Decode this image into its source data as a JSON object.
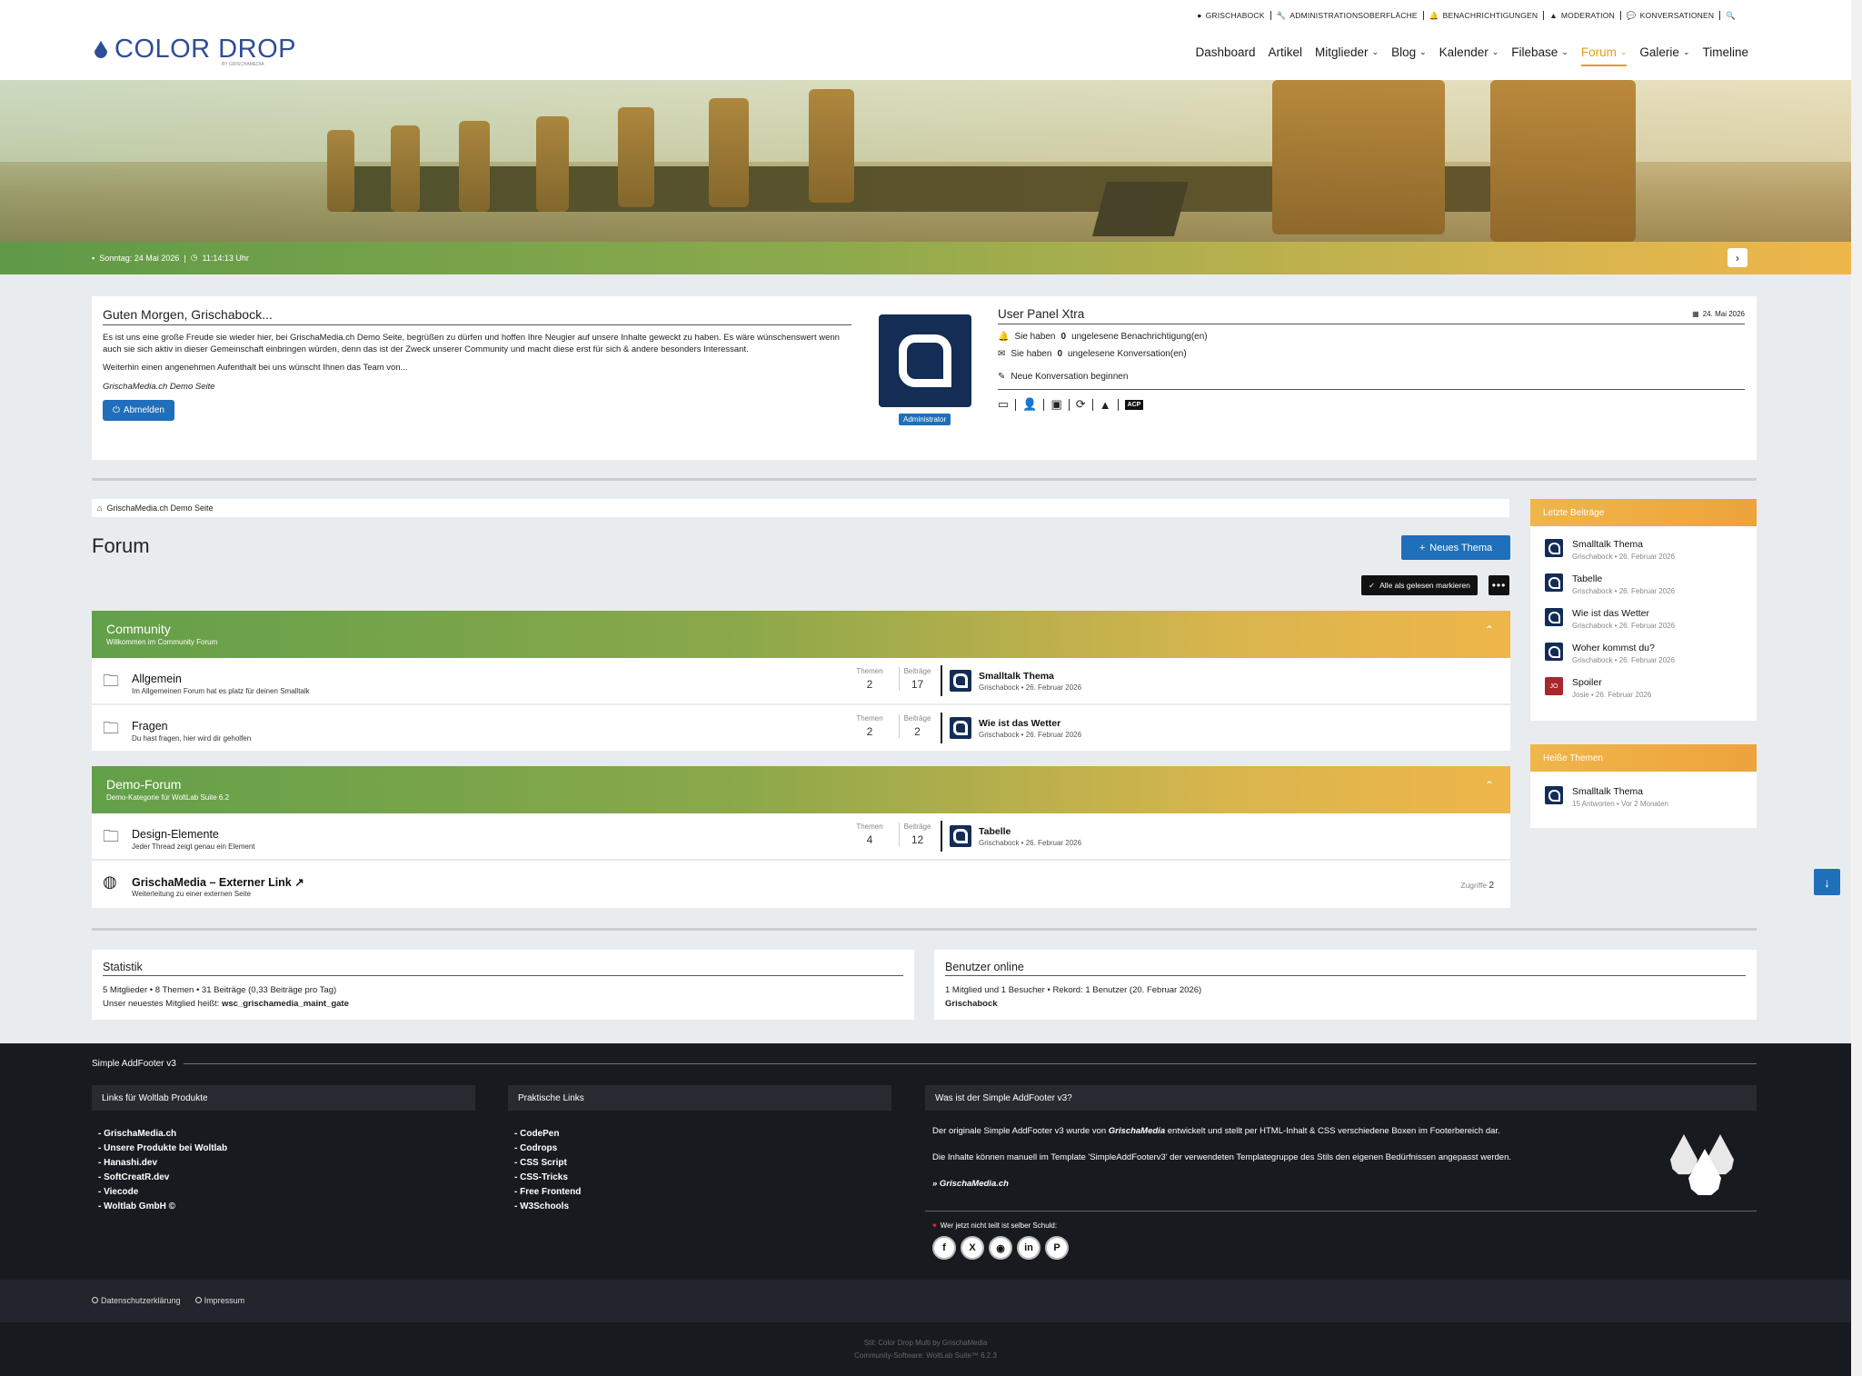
{
  "topbar": {
    "links": [
      {
        "icon": "user-circle-icon",
        "label": "GRISCHABOCK"
      },
      {
        "icon": "wrench-icon",
        "label": "ADMINISTRATIONSOBERFLÄCHE"
      },
      {
        "icon": "bell-icon",
        "label": "BENACHRICHTIGUNGEN"
      },
      {
        "icon": "warning-icon",
        "label": "MODERATION"
      },
      {
        "icon": "chat-icon",
        "label": "KONVERSATIONEN"
      }
    ]
  },
  "logo": {
    "name": "COLOR DROP",
    "sub": "BY GRISCHAMEDIA"
  },
  "nav": [
    {
      "label": "Dashboard",
      "dropdown": false
    },
    {
      "label": "Artikel",
      "dropdown": false
    },
    {
      "label": "Mitglieder",
      "dropdown": true
    },
    {
      "label": "Blog",
      "dropdown": true
    },
    {
      "label": "Kalender",
      "dropdown": true
    },
    {
      "label": "Filebase",
      "dropdown": true
    },
    {
      "label": "Forum",
      "dropdown": true,
      "active": true
    },
    {
      "label": "Galerie",
      "dropdown": true
    },
    {
      "label": "Timeline",
      "dropdown": false
    }
  ],
  "hero": {
    "date": "Sonntag: 24 Mai 2026",
    "time": "11:14:13 Uhr"
  },
  "welcome": {
    "title": "Guten Morgen, Grischabock...",
    "p1": "Es ist uns eine große Freude sie wieder hier, bei GrischaMedia.ch Demo Seite, begrüßen zu dürfen und hoffen Ihre Neugier auf unsere Inhalte geweckt zu haben. Es wäre wünschenswert wenn auch sie sich aktiv in dieser Gemeinschaft einbringen würden, denn das ist der Zweck unserer Community und macht diese erst für sich & andere besonders Interessant.",
    "p2": "Weiterhin einen angenehmen Aufenthalt bei uns wünscht Ihnen das Team von...",
    "signature": "GrischaMedia.ch Demo Seite",
    "logout": "Abmelden",
    "badge": "Administrator"
  },
  "userpanel": {
    "title": "User Panel Xtra",
    "date": "24. Mai 2026",
    "notif_pre": "Sie haben",
    "notif_count": "0",
    "notif_post": "ungelesene Benachrichtigung(en)",
    "conv_pre": "Sie haben",
    "conv_count": "0",
    "conv_post": "ungelesene Konversation(en)",
    "new_conv": "Neue Konversation beginnen",
    "acp": "ACP"
  },
  "breadcrumb": "GrischaMedia.ch Demo Seite",
  "forum": {
    "title": "Forum",
    "new_thread": "Neues Thema",
    "mark_read": "Alle als gelesen markieren"
  },
  "stat_labels": {
    "threads": "Themen",
    "posts": "Beiträge",
    "hits": "Zugriffe"
  },
  "categories": [
    {
      "title": "Community",
      "subtitle": "Willkommen im Community Forum",
      "boards": [
        {
          "name": "Allgemein",
          "desc": "Im Allgemeinen Forum hat es platz für deinen Smalltalk",
          "threads": "2",
          "posts": "17",
          "last_title": "Smalltalk Thema",
          "last_meta": "Grischabock • 26. Februar 2026"
        },
        {
          "name": "Fragen",
          "desc": "Du hast fragen, hier wird dir geholfen",
          "threads": "2",
          "posts": "2",
          "last_title": "Wie ist das Wetter",
          "last_meta": "Grischabock • 26. Februar 2026"
        }
      ]
    },
    {
      "title": "Demo-Forum",
      "subtitle": "Demo-Kategorie für WoltLab Suite 6.2",
      "boards": [
        {
          "name": "Design-Elemente",
          "desc": "Jeder Thread zeigt genau ein Element",
          "threads": "4",
          "posts": "12",
          "last_title": "Tabelle",
          "last_meta": "Grischabock • 26. Februar 2026"
        },
        {
          "name": "GrischaMedia – Externer Link",
          "desc": "Weiterleitung zu einer externen Seite",
          "hits": "2"
        }
      ]
    }
  ],
  "sidebar": {
    "latest_title": "Letzte Beiträge",
    "latest": [
      {
        "title": "Smalltalk Thema",
        "meta": "Grischabock • 26. Februar 2026",
        "avatar": "q"
      },
      {
        "title": "Tabelle",
        "meta": "Grischabock • 26. Februar 2026",
        "avatar": "q"
      },
      {
        "title": "Wie ist das Wetter",
        "meta": "Grischabock • 26. Februar 2026",
        "avatar": "q"
      },
      {
        "title": "Woher kommst du?",
        "meta": "Grischabock • 26. Februar 2026",
        "avatar": "q"
      },
      {
        "title": "Spoiler",
        "meta": "Josie • 26. Februar 2026",
        "avatar": "JO"
      }
    ],
    "hot_title": "Heiße Themen",
    "hot": [
      {
        "title": "Smalltalk Thema",
        "meta": "15 Antworten • Vor 2 Monaten"
      }
    ]
  },
  "stats": {
    "title": "Statistik",
    "line1": "5 Mitglieder  •  8 Themen  •  31 Beiträge (0,33 Beiträge pro Tag)",
    "line2_pre": "Unser neuestes Mitglied heißt:",
    "line2_user": "wsc_grischamedia_maint_gate"
  },
  "online": {
    "title": "Benutzer online",
    "line1": "1 Mitglied und 1 Besucher  •  Rekord: 1 Benutzer (20. Februar 2026)",
    "user": "Grischabock"
  },
  "footer": {
    "title": "Simple AddFooter v3",
    "col1_title": "Links für Woltlab Produkte",
    "col1": [
      "GrischaMedia.ch",
      "Unsere Produkte bei Woltlab",
      "Hanashi.dev",
      "SoftCreatR.dev",
      "Viecode",
      "Woltlab GmbH ©"
    ],
    "col2_title": "Praktische Links",
    "col2": [
      "CodePen",
      "Codrops",
      "CSS Script",
      "CSS-Tricks",
      "Free Frontend",
      "W3Schools"
    ],
    "col3_title": "Was ist der Simple AddFooter v3?",
    "p1_pre": "Der originale Simple AddFooter v3 wurde von",
    "p1_brand": "GrischaMedia",
    "p1_post": "entwickelt und stellt per HTML-Inhalt & CSS verschiedene Boxen im Footerbereich dar.",
    "p2": "Die Inhalte können manuell im Template 'SimpleAddFooterv3' der verwendeten Templategruppe des Stils den eigenen Bedürfnissen angepasst werden.",
    "p3": "» GrischaMedia.ch",
    "share": "Wer jetzt nicht teilt ist selber Schuld:",
    "social": [
      "facebook",
      "x",
      "reddit",
      "linkedin",
      "pinterest"
    ]
  },
  "bottom": {
    "privacy": "Datenschutzerklärung",
    "imprint": "Impressum"
  },
  "copyright": {
    "line1": "Stil: Color Drop Multi by GrischaMedia",
    "line2": "Community-Software: WoltLab Suite™ 6.2.3"
  }
}
